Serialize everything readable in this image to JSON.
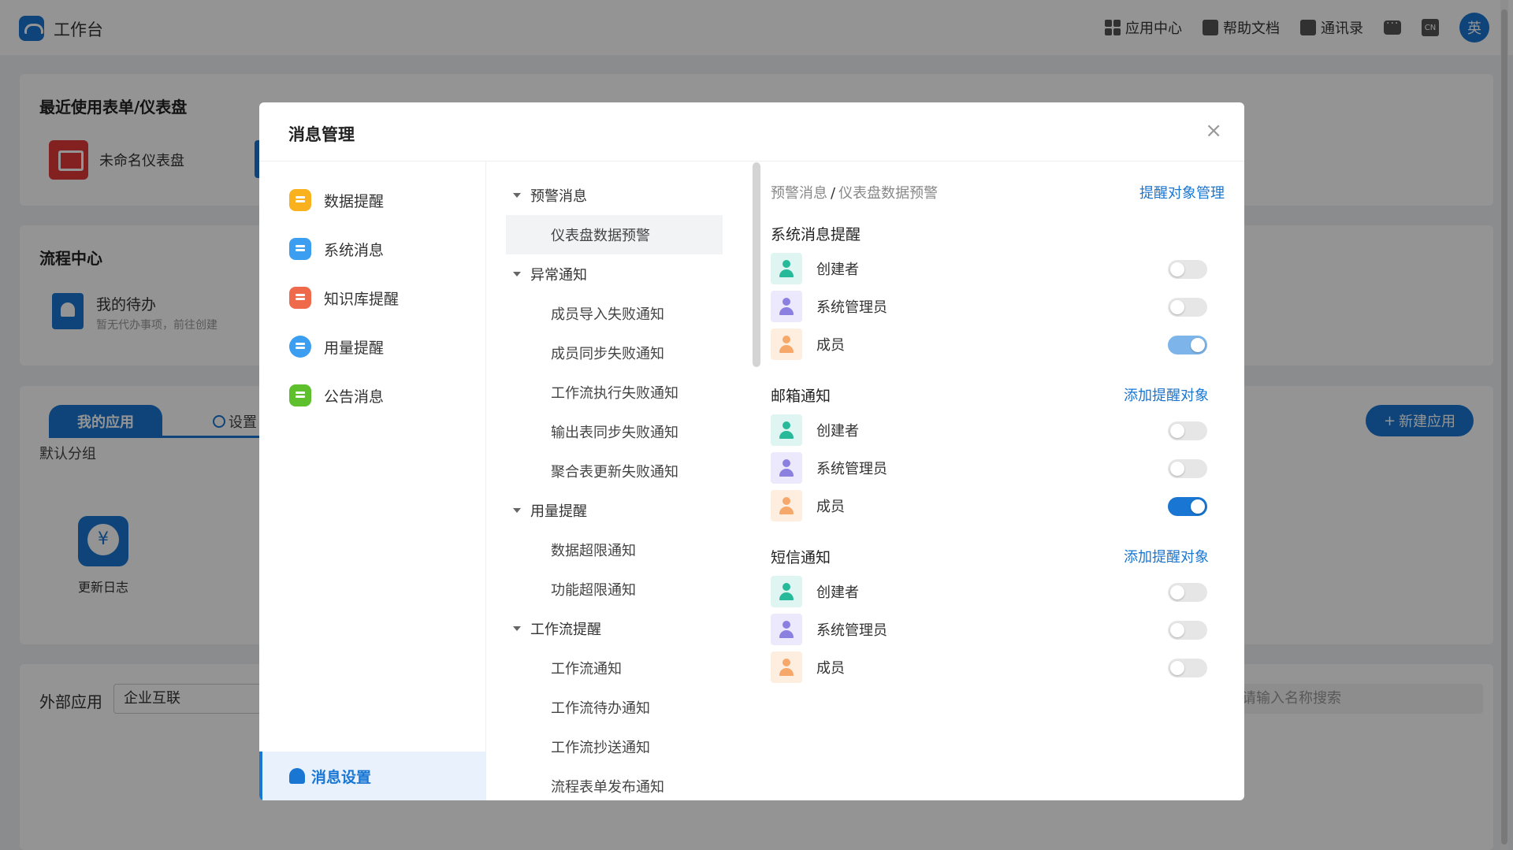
{
  "app": {
    "title": "工作台",
    "top_actions": [
      "应用中心",
      "帮助文档",
      "通讯录"
    ],
    "lang_icon": "CN",
    "avatar": "英"
  },
  "background": {
    "recent_title": "最近使用表单/仪表盘",
    "recent_item": "未命名仪表盘",
    "process_title": "流程中心",
    "todo_title": "我的待办",
    "todo_sub": "暂无代办事项，前往创建",
    "tab_my_apps": "我的应用",
    "tab_settings": "设置",
    "default_group": "默认分组",
    "update_log": "更新日志",
    "new_app": "新建应用",
    "external_apps": "外部应用",
    "external_select": "企业互联",
    "search_placeholder": "请输入名称搜索"
  },
  "modal": {
    "title": "消息管理",
    "close": "×",
    "nav": [
      {
        "label": "数据提醒",
        "icon": "data-reminder-icon",
        "color": "#f9b21d"
      },
      {
        "label": "系统消息",
        "icon": "system-message-icon",
        "color": "#3c9ef0"
      },
      {
        "label": "知识库提醒",
        "icon": "knowledge-base-icon",
        "color": "#ef6a4b"
      },
      {
        "label": "用量提醒",
        "icon": "usage-icon",
        "color": "#3c9ef0"
      },
      {
        "label": "公告消息",
        "icon": "announcement-icon",
        "color": "#5dc02c"
      }
    ],
    "nav_settings": "消息设置",
    "tree": {
      "alert": {
        "label": "预警消息",
        "items": [
          "仪表盘数据预警"
        ]
      },
      "exception": {
        "label": "异常通知",
        "items": [
          "成员导入失败通知",
          "成员同步失败通知",
          "工作流执行失败通知",
          "输出表同步失败通知",
          "聚合表更新失败通知"
        ]
      },
      "usage": {
        "label": "用量提醒",
        "items": [
          "数据超限通知",
          "功能超限通知"
        ]
      },
      "workflow": {
        "label": "工作流提醒",
        "items": [
          "工作流通知",
          "工作流待办通知",
          "工作流抄送通知",
          "流程表单发布通知"
        ]
      }
    },
    "content": {
      "crumb_parent": "预警消息",
      "crumb_sep": "/",
      "crumb_current": "仪表盘数据预警",
      "manage_link": "提醒对象管理",
      "add_link": "添加提醒对象",
      "sections": [
        {
          "title": "系统消息提醒",
          "rows": [
            {
              "label": "创建者",
              "on": false
            },
            {
              "label": "系统管理员",
              "on": false
            },
            {
              "label": "成员",
              "on": true
            }
          ]
        },
        {
          "title": "邮箱通知",
          "rows": [
            {
              "label": "创建者",
              "on": false
            },
            {
              "label": "系统管理员",
              "on": false
            },
            {
              "label": "成员",
              "on": true
            }
          ]
        },
        {
          "title": "短信通知",
          "rows": [
            {
              "label": "创建者",
              "on": false
            },
            {
              "label": "系统管理员",
              "on": false
            },
            {
              "label": "成员",
              "on": false
            }
          ]
        }
      ]
    }
  }
}
